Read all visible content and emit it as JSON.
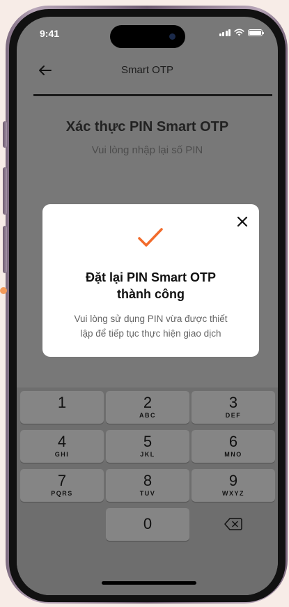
{
  "status_bar": {
    "time": "9:41"
  },
  "nav": {
    "title": "Smart OTP"
  },
  "pin_screen": {
    "title": "Xác thực PIN Smart OTP",
    "subtitle": "Vui lòng nhập lại số PIN"
  },
  "dialog": {
    "title_line1": "Đặt lại PIN Smart OTP",
    "title_line2": "thành công",
    "message_line1": "Vui lòng sử dụng PIN vừa được thiết",
    "message_line2": "lập để tiếp tục thực hiện giao dịch",
    "icon": "checkmark-icon",
    "close_icon": "close-icon",
    "accent_color": "#f26b2b"
  },
  "keypad": {
    "keys": [
      {
        "digit": "1",
        "letters": ""
      },
      {
        "digit": "2",
        "letters": "ABC"
      },
      {
        "digit": "3",
        "letters": "DEF"
      },
      {
        "digit": "4",
        "letters": "GHI"
      },
      {
        "digit": "5",
        "letters": "JKL"
      },
      {
        "digit": "6",
        "letters": "MNO"
      },
      {
        "digit": "7",
        "letters": "PQRS"
      },
      {
        "digit": "8",
        "letters": "TUV"
      },
      {
        "digit": "9",
        "letters": "WXYZ"
      },
      {
        "digit": "0",
        "letters": ""
      }
    ],
    "delete_icon": "backspace-icon"
  }
}
